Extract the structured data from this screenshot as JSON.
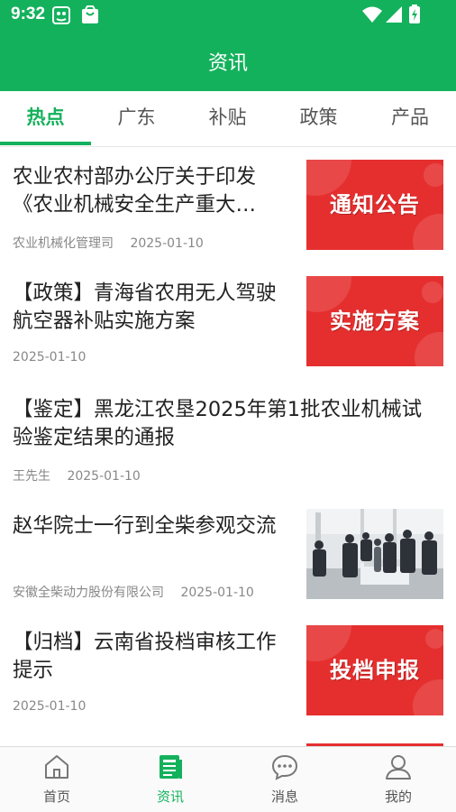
{
  "status_bar": {
    "time": "9:32"
  },
  "header": {
    "title": "资讯"
  },
  "tabs": [
    {
      "label": "热点",
      "active": true
    },
    {
      "label": "广东",
      "active": false
    },
    {
      "label": "补贴",
      "active": false
    },
    {
      "label": "政策",
      "active": false
    },
    {
      "label": "产品",
      "active": false
    }
  ],
  "news": [
    {
      "title": "农业农村部办公厅关于印发《农业机械安全生产重大…",
      "source": "农业机械化管理司",
      "date": "2025-01-10",
      "thumb_text": "通知公告"
    },
    {
      "title": "【政策】青海省农用无人驾驶航空器补贴实施方案",
      "source": "",
      "date": "2025-01-10",
      "thumb_text": "实施方案"
    },
    {
      "title": "【鉴定】黑龙江农垦2025年第1批农业机械试验鉴定结果的通报",
      "source": "王先生",
      "date": "2025-01-10"
    },
    {
      "title": "赵华院士一行到全柴参观交流",
      "source": "安徽全柴动力股份有限公司",
      "date": "2025-01-10"
    },
    {
      "title": "【归档】云南省投档审核工作提示",
      "source": "",
      "date": "2025-01-10",
      "thumb_text": "投档申报"
    }
  ],
  "bottom_nav": [
    {
      "label": "首页",
      "icon": "home-icon",
      "active": false
    },
    {
      "label": "资讯",
      "icon": "news-icon",
      "active": true
    },
    {
      "label": "消息",
      "icon": "message-icon",
      "active": false
    },
    {
      "label": "我的",
      "icon": "profile-icon",
      "active": false
    }
  ],
  "colors": {
    "brand": "#14b15c",
    "thumb_red": "#e52f2f"
  }
}
